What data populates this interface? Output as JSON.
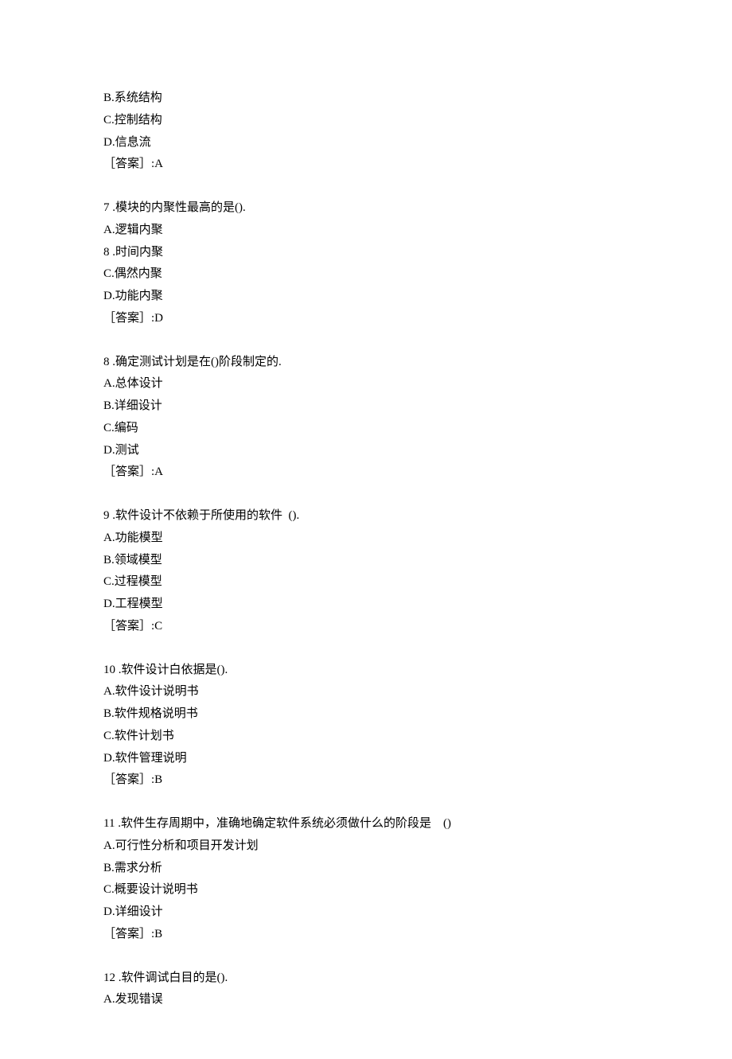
{
  "blocks": [
    {
      "lines": [
        "B.系统结构",
        "C.控制结构",
        "D.信息流",
        "［答案］:A"
      ]
    },
    {
      "lines": [
        "7 .模块的内聚性最高的是().",
        "A.逻辑内聚",
        "8 .时间内聚",
        "C.偶然内聚",
        "D.功能内聚",
        "［答案］:D"
      ]
    },
    {
      "lines": [
        "8 .确定测试计划是在()阶段制定的.",
        "A.总体设计",
        "B.详细设计",
        "C.编码",
        "D.测试",
        "［答案］:A"
      ]
    },
    {
      "lines": [
        "9 .软件设计不依赖于所使用的软件  ().",
        "A.功能模型",
        "B.领域模型",
        "C.过程模型",
        "D.工程模型",
        "［答案］:C"
      ]
    },
    {
      "lines": [
        "10 .软件设计白依据是().",
        "A.软件设计说明书",
        "B.软件规格说明书",
        "C.软件计划书",
        "D.软件管理说明",
        "［答案］:B"
      ]
    },
    {
      "lines": [
        "11 .软件生存周期中，准确地确定软件系统必须做什么的阶段是    ()",
        "A.可行性分析和项目开发计划",
        "B.需求分析",
        "C.概要设计说明书",
        "D.详细设计",
        "［答案］:B"
      ]
    },
    {
      "lines": [
        "12 .软件调试白目的是().",
        "A.发现错误"
      ]
    }
  ]
}
